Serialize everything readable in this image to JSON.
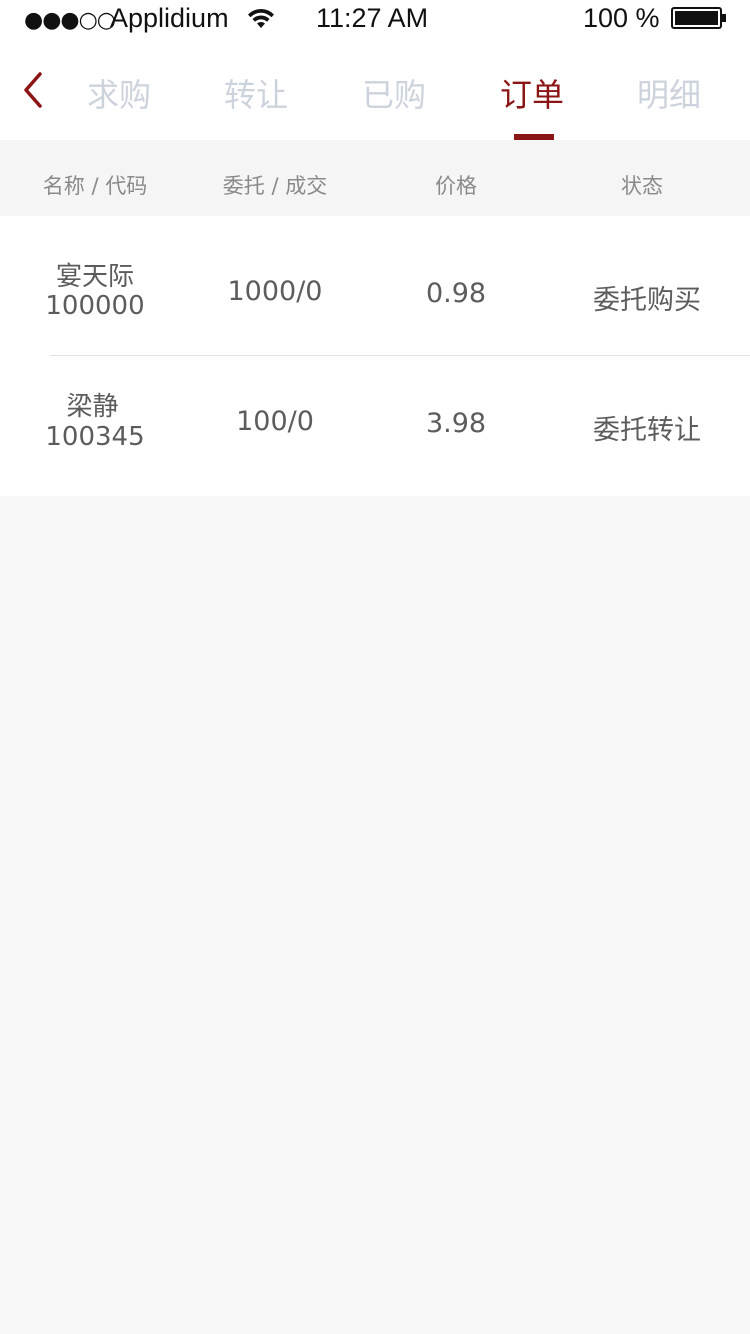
{
  "status_bar": {
    "signal": "●●●○○",
    "carrier": "Applidium",
    "time": "11:27 AM",
    "battery_percent": "100 %"
  },
  "nav": {
    "tabs": [
      {
        "label": "求购",
        "active": false
      },
      {
        "label": "转让",
        "active": false
      },
      {
        "label": "已购",
        "active": false
      },
      {
        "label": "订单",
        "active": true
      },
      {
        "label": "明细",
        "active": false
      }
    ],
    "accent_color": "#8b1414",
    "inactive_color": "#cdd3dc"
  },
  "table": {
    "headers": [
      "名称 / 代码",
      "委托 / 成交",
      "价格",
      "状态"
    ],
    "rows": [
      {
        "name": "宴天际",
        "code": "100000",
        "order": "1000/0",
        "price": "0.98",
        "status": "委托购买"
      },
      {
        "name": "梁静",
        "code": "100345",
        "order": "100/0",
        "price": "3.98",
        "status": "委托转让"
      }
    ]
  }
}
